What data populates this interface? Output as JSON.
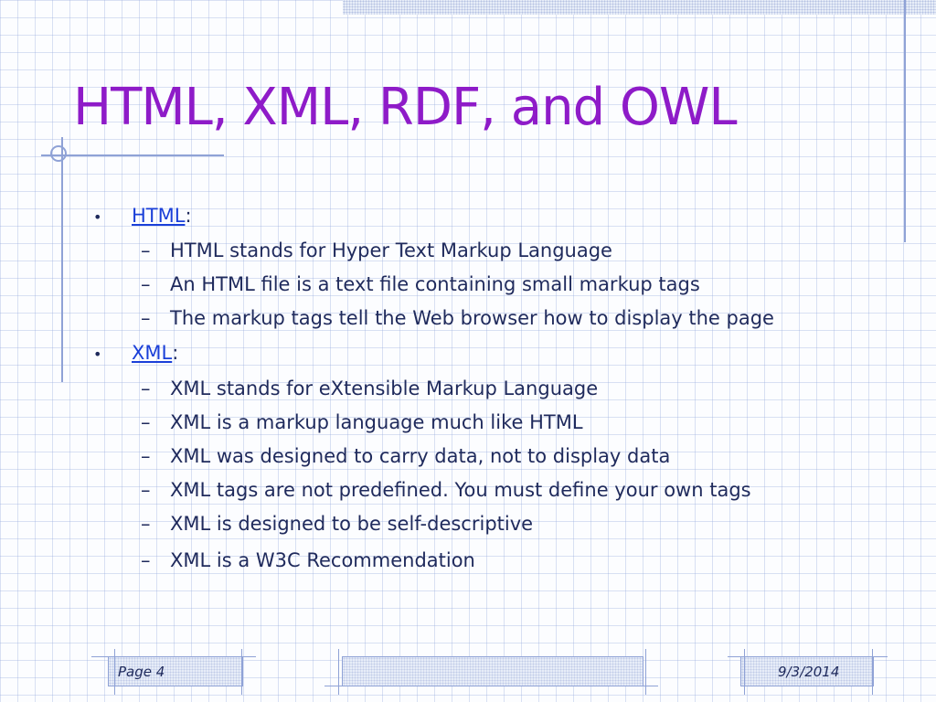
{
  "slide": {
    "title": "HTML, XML, RDF, and OWL",
    "bullets": [
      {
        "link": "HTML",
        "suffix": ":",
        "subs": [
          "HTML stands for Hyper Text Markup Language",
          "An HTML file is a text file containing small markup tags",
          "The markup tags tell the Web browser how to display the page"
        ]
      },
      {
        "link": "XML",
        "suffix": ":",
        "subs": [
          "XML stands for eXtensible Markup Language",
          "XML is a markup language much like HTML",
          "XML was designed to carry data, not to display data",
          "XML tags are not predefined. You must define your own tags",
          "XML is designed to be self-descriptive",
          "XML is a W3C Recommendation"
        ]
      }
    ],
    "bullet_glyph": "•",
    "sub_glyph": "–"
  },
  "footer": {
    "page": "Page 4",
    "date": "9/3/2014"
  },
  "colors": {
    "title": "#8e1bc8",
    "text": "#1f2a5c",
    "link": "#1a3fd8",
    "grid": "#8fa2d6"
  }
}
